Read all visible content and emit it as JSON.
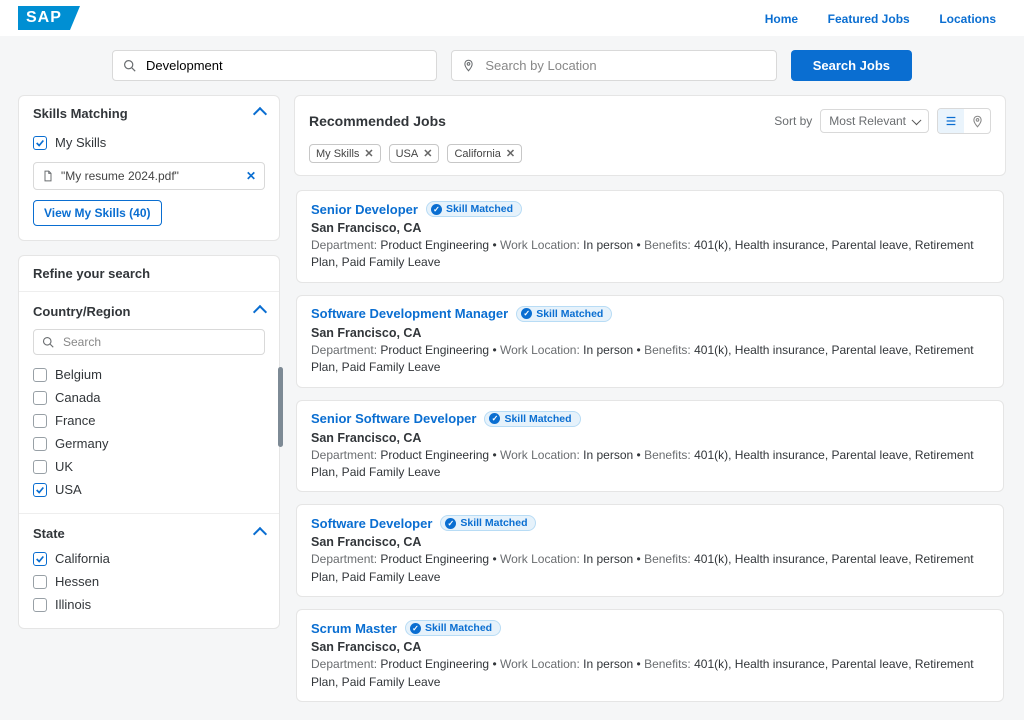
{
  "brand": "SAP",
  "nav": {
    "home": "Home",
    "featured": "Featured Jobs",
    "locations": "Locations"
  },
  "search": {
    "keyword_value": "Development",
    "location_placeholder": "Search by Location",
    "button": "Search Jobs"
  },
  "skills_panel": {
    "title": "Skills Matching",
    "my_skills_label": "My Skills",
    "my_skills_checked": true,
    "resume_name": "\"My resume 2024.pdf\"",
    "view_skills_label": "View My Skills (40)"
  },
  "refine": {
    "title": "Refine your search",
    "country": {
      "title": "Country/Region",
      "search_placeholder": "Search",
      "options": [
        {
          "label": "Belgium",
          "checked": false
        },
        {
          "label": "Canada",
          "checked": false
        },
        {
          "label": "France",
          "checked": false
        },
        {
          "label": "Germany",
          "checked": false
        },
        {
          "label": "UK",
          "checked": false
        },
        {
          "label": "USA",
          "checked": true
        }
      ]
    },
    "state": {
      "title": "State",
      "options": [
        {
          "label": "California",
          "checked": true
        },
        {
          "label": "Hessen",
          "checked": false
        },
        {
          "label": "Illinois",
          "checked": false
        }
      ]
    }
  },
  "results": {
    "title": "Recommended Jobs",
    "sort_label": "Sort by",
    "sort_value": "Most Relevant",
    "filter_chips": [
      "My Skills",
      "USA",
      "California"
    ],
    "jobs": [
      {
        "title": "Senior Developer",
        "skill_matched": "Skill Matched",
        "location": "San Francisco, CA",
        "department_label": "Department:",
        "department": "Product Engineering",
        "work_location_label": "Work Location:",
        "work_location": "In person",
        "benefits_label": "Benefits:",
        "benefits": "401(k), Health insurance, Parental leave, Retirement Plan, Paid Family Leave"
      },
      {
        "title": "Software Development Manager",
        "skill_matched": "Skill Matched",
        "location": "San Francisco, CA",
        "department_label": "Department:",
        "department": "Product Engineering",
        "work_location_label": "Work Location:",
        "work_location": "In person",
        "benefits_label": "Benefits:",
        "benefits": "401(k), Health insurance, Parental leave, Retirement Plan, Paid Family Leave"
      },
      {
        "title": "Senior Software Developer",
        "skill_matched": "Skill Matched",
        "location": "San Francisco, CA",
        "department_label": "Department:",
        "department": "Product Engineering",
        "work_location_label": "Work Location:",
        "work_location": "In person",
        "benefits_label": "Benefits:",
        "benefits": "401(k), Health insurance, Parental leave, Retirement Plan, Paid Family Leave"
      },
      {
        "title": "Software Developer",
        "skill_matched": "Skill Matched",
        "location": "San Francisco, CA",
        "department_label": "Department:",
        "department": "Product Engineering",
        "work_location_label": "Work Location:",
        "work_location": "In person",
        "benefits_label": "Benefits:",
        "benefits": "401(k), Health insurance, Parental leave, Retirement Plan, Paid Family Leave"
      },
      {
        "title": "Scrum Master",
        "skill_matched": "Skill Matched",
        "location": "San Francisco, CA",
        "department_label": "Department:",
        "department": "Product Engineering",
        "work_location_label": "Work Location:",
        "work_location": "In person",
        "benefits_label": "Benefits:",
        "benefits": "401(k), Health insurance, Parental leave, Retirement Plan, Paid Family Leave"
      }
    ]
  }
}
